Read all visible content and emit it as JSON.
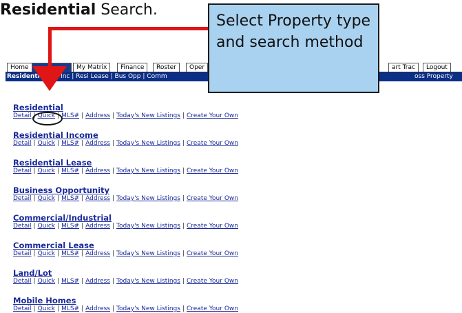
{
  "heading": {
    "bold": "Residential",
    "rest": " Search."
  },
  "callout": {
    "text": "Select Property type and search method"
  },
  "tabs": [
    {
      "label": "Home",
      "active": false
    },
    {
      "label": "",
      "active": true
    },
    {
      "label": "My Matrix",
      "active": false
    },
    {
      "label": "Finance",
      "active": false
    },
    {
      "label": "Roster",
      "active": false
    },
    {
      "label": "Oper",
      "active": false
    },
    {
      "label": "art Trac",
      "active": false
    },
    {
      "label": "Logout",
      "active": false
    }
  ],
  "subnav": {
    "items": [
      "Residenti",
      "Resi Inc",
      "Resi Lease",
      "Bus Opp",
      "Comm"
    ],
    "separator": "|",
    "right": "oss Property"
  },
  "link_labels": {
    "detail": "Detail",
    "quick": "Quick",
    "mls": "MLS#",
    "address": "Address",
    "todays": "Today's New Listings",
    "create": "Create Your Own",
    "separator": "|"
  },
  "sections": [
    {
      "title": "Residential"
    },
    {
      "title": "Residential Income"
    },
    {
      "title": "Residential Lease"
    },
    {
      "title": "Business Opportunity"
    },
    {
      "title": "Commercial/Industrial"
    },
    {
      "title": "Commercial Lease"
    },
    {
      "title": "Land/Lot"
    },
    {
      "title": "Mobile Homes"
    }
  ],
  "colors": {
    "callout_bg": "#a9d2f0",
    "arrow": "#e01616",
    "nav_bg": "#0b2f86",
    "link": "#1a2a9a"
  }
}
